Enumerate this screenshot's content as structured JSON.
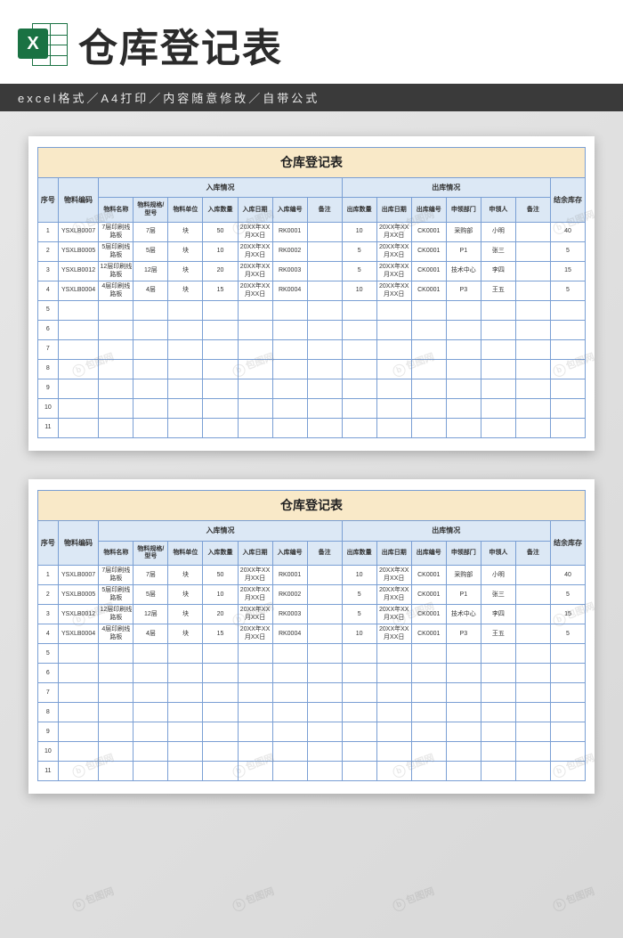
{
  "header": {
    "logo_letter": "X",
    "title": "仓库登记表",
    "subtitle": "excel格式／A4打印／内容随意修改／自带公式"
  },
  "chart_data": {
    "type": "table",
    "title": "仓库登记表",
    "columns": {
      "seq": "序号",
      "material_code": "物料编码",
      "in_group": "入库情况",
      "out_group": "出库情况",
      "remain": "结余库存",
      "material_name": "物料名称",
      "spec": "物料规格/型号",
      "unit": "物料单位",
      "in_qty": "入库数量",
      "in_date": "入库日期",
      "in_no": "入库编号",
      "in_remark": "备注",
      "out_qty": "出库数量",
      "out_date": "出库日期",
      "out_no": "出库编号",
      "dept": "申领部门",
      "person": "申领人",
      "out_remark": "备注"
    },
    "rows": [
      {
        "seq": "1",
        "code": "YSXLB0007",
        "name": "7层印刷线路板",
        "spec": "7层",
        "unit": "块",
        "in_qty": "50",
        "in_date": "20XX年XX月XX日",
        "in_no": "RK0001",
        "in_remark": "",
        "out_qty": "10",
        "out_date": "20XX年XX月XX日",
        "out_no": "CK0001",
        "dept": "采购部",
        "person": "小明",
        "out_remark": "",
        "remain": "40"
      },
      {
        "seq": "2",
        "code": "YSXLB0005",
        "name": "5层印刷线路板",
        "spec": "5层",
        "unit": "块",
        "in_qty": "10",
        "in_date": "20XX年XX月XX日",
        "in_no": "RK0002",
        "in_remark": "",
        "out_qty": "5",
        "out_date": "20XX年XX月XX日",
        "out_no": "CK0001",
        "dept": "P1",
        "person": "张三",
        "out_remark": "",
        "remain": "5"
      },
      {
        "seq": "3",
        "code": "YSXLB0012",
        "name": "12层印刷线路板",
        "spec": "12层",
        "unit": "块",
        "in_qty": "20",
        "in_date": "20XX年XX月XX日",
        "in_no": "RK0003",
        "in_remark": "",
        "out_qty": "5",
        "out_date": "20XX年XX月XX日",
        "out_no": "CK0001",
        "dept": "技术中心",
        "person": "李四",
        "out_remark": "",
        "remain": "15"
      },
      {
        "seq": "4",
        "code": "YSXLB0004",
        "name": "4层印刷线路板",
        "spec": "4层",
        "unit": "块",
        "in_qty": "15",
        "in_date": "20XX年XX月XX日",
        "in_no": "RK0004",
        "in_remark": "",
        "out_qty": "10",
        "out_date": "20XX年XX月XX日",
        "out_no": "CK0001",
        "dept": "P3",
        "person": "王五",
        "out_remark": "",
        "remain": "5"
      },
      {
        "seq": "5"
      },
      {
        "seq": "6"
      },
      {
        "seq": "7"
      },
      {
        "seq": "8"
      },
      {
        "seq": "9"
      },
      {
        "seq": "10"
      },
      {
        "seq": "11"
      }
    ]
  },
  "watermark": "包图网"
}
